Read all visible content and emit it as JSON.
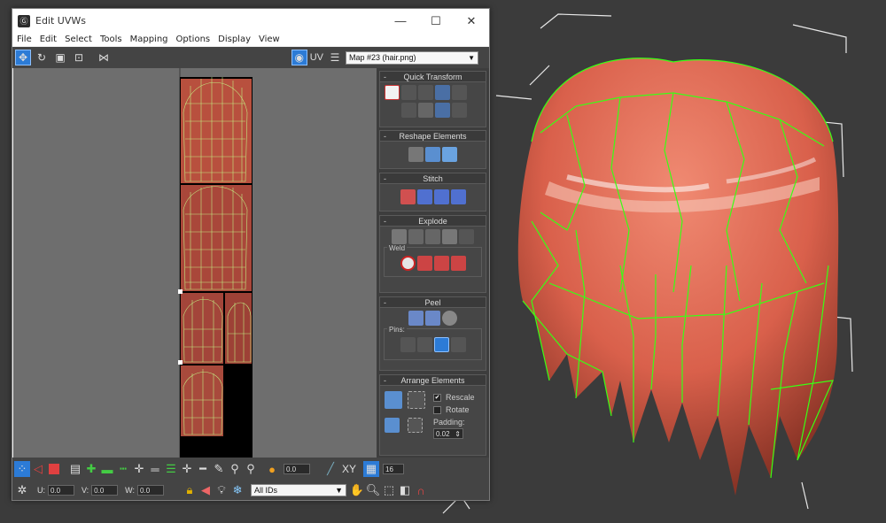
{
  "window": {
    "title": "Edit UVWs",
    "minimize": "—",
    "maximize": "☐",
    "close": "✕",
    "app_icon": "Ⓖ"
  },
  "menu": [
    "File",
    "Edit",
    "Select",
    "Tools",
    "Mapping",
    "Options",
    "Display",
    "View"
  ],
  "toolbar": {
    "uv_label": "UV",
    "map_selected": "Map #23 (hair.png)"
  },
  "rollouts": {
    "quick_transform": "Quick Transform",
    "reshape": "Reshape Elements",
    "stitch": "Stitch",
    "explode": "Explode",
    "weld": "Weld",
    "peel": "Peel",
    "pins": "Pins:",
    "arrange": "Arrange Elements",
    "rescale": "Rescale",
    "rotate": "Rotate",
    "padding": "Padding:",
    "padding_value": "0.02"
  },
  "bottom": {
    "value_a": "0.0",
    "xy": "XY",
    "count": "16",
    "u_label": "U:",
    "u_value": "0.0",
    "v_label": "V:",
    "v_value": "0.0",
    "w_label": "W:",
    "w_value": "0.0",
    "ids": "All IDs"
  },
  "colors": {
    "accent": "#2c7bd6",
    "wire": "#39ff14",
    "hair": "#e06a55"
  }
}
